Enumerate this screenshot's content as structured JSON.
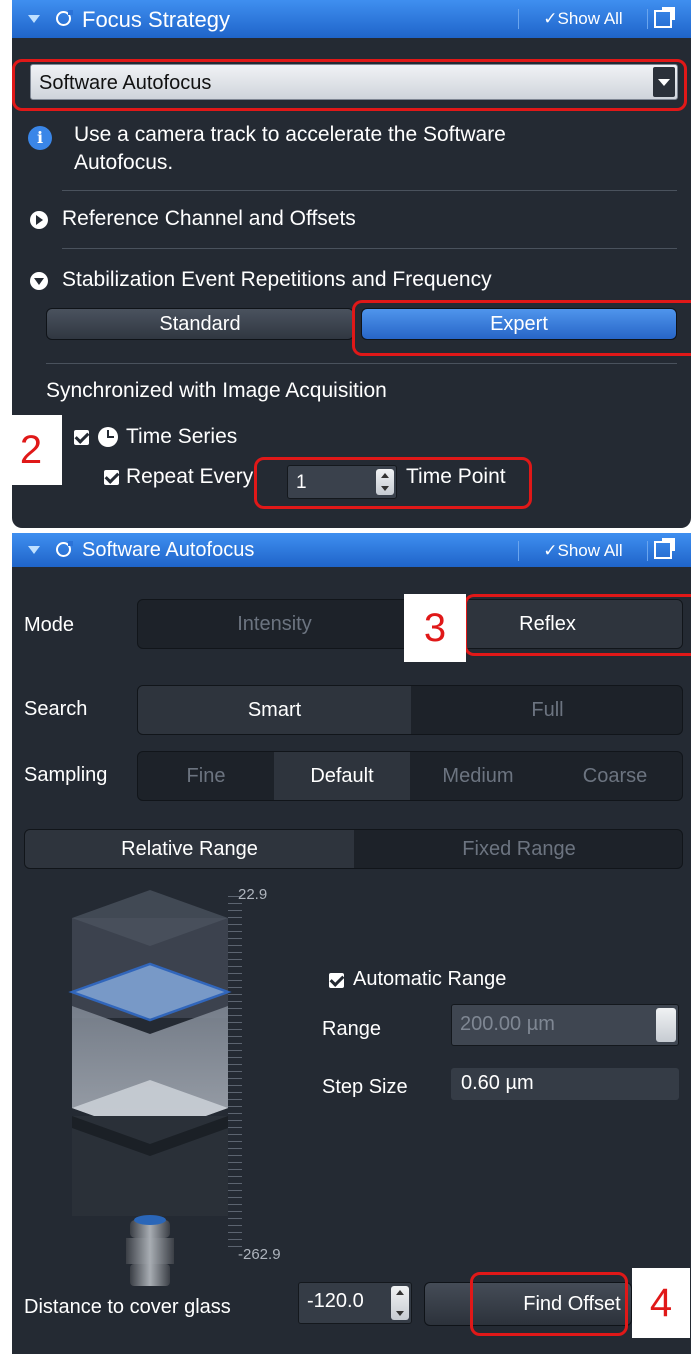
{
  "focus_strategy": {
    "title": "Focus Strategy",
    "show_all": "✓Show All",
    "strategy_value": "Software Autofocus",
    "info_line1": "Use a camera track to accelerate the Software",
    "info_line2": "Autofocus.",
    "reference_channel": "Reference Channel and Offsets",
    "stabilization": "Stabilization Event Repetitions and Frequency",
    "mode_standard": "Standard",
    "mode_expert": "Expert",
    "sync_label": "Synchronized with Image Acquisition",
    "time_series": "Time Series",
    "repeat_every": "Repeat Every",
    "repeat_value": "1",
    "time_point": "Time Point"
  },
  "software_autofocus": {
    "title": "Software Autofocus",
    "show_all": "✓Show All",
    "mode_label": "Mode",
    "mode_options": [
      "Intensity",
      "Reflex"
    ],
    "search_label": "Search",
    "search_options": [
      "Smart",
      "Full"
    ],
    "sampling_label": "Sampling",
    "sampling_options": [
      "Fine",
      "Default",
      "Medium",
      "Coarse"
    ],
    "range_options": [
      "Relative Range",
      "Fixed Range"
    ],
    "scale_top": "22.9",
    "scale_bottom": "-262.9",
    "automatic_range": "Automatic Range",
    "range_label": "Range",
    "range_value": "200.00 µm",
    "step_size_label": "Step Size",
    "step_size_value": "0.60 µm",
    "distance_label": "Distance to cover glass",
    "distance_value": "-120.0",
    "find_offset": "Find Offset"
  },
  "callouts": {
    "c2": "2",
    "c3": "3",
    "c4": "4"
  },
  "colors": {
    "accent": "#2a72d8",
    "highlight": "#e01818",
    "panel_bg": "#242a33"
  }
}
